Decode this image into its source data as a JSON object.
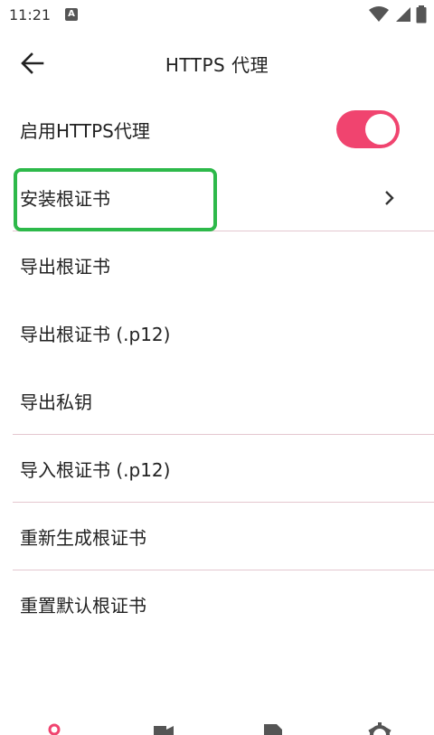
{
  "status_bar": {
    "time": "11:21",
    "notification_icon": "a-icon",
    "icons": [
      "wifi-icon",
      "signal-icon",
      "battery-icon"
    ]
  },
  "toolbar": {
    "back_icon": "arrow-left-icon",
    "title": "HTTPS 代理"
  },
  "rows": [
    {
      "label": "启用HTTPS代理",
      "control": "toggle",
      "toggle_on": true
    },
    {
      "label": "安装根证书",
      "control": "chevron",
      "highlighted": true
    },
    {
      "label": "导出根证书"
    },
    {
      "label": "导出根证书 (.p12)"
    },
    {
      "label": "导出私钥"
    },
    {
      "label": "导入根证书 (.p12)"
    },
    {
      "label": "重新生成根证书"
    },
    {
      "label": "重置默认根证书"
    }
  ],
  "bottom_nav": {
    "items": [
      "person-icon",
      "video-icon",
      "document-icon",
      "gear-icon"
    ],
    "active_index": 0
  },
  "colors": {
    "accent": "#f0446f",
    "highlight": "#2db94a",
    "divider": "#e4c7cf"
  }
}
